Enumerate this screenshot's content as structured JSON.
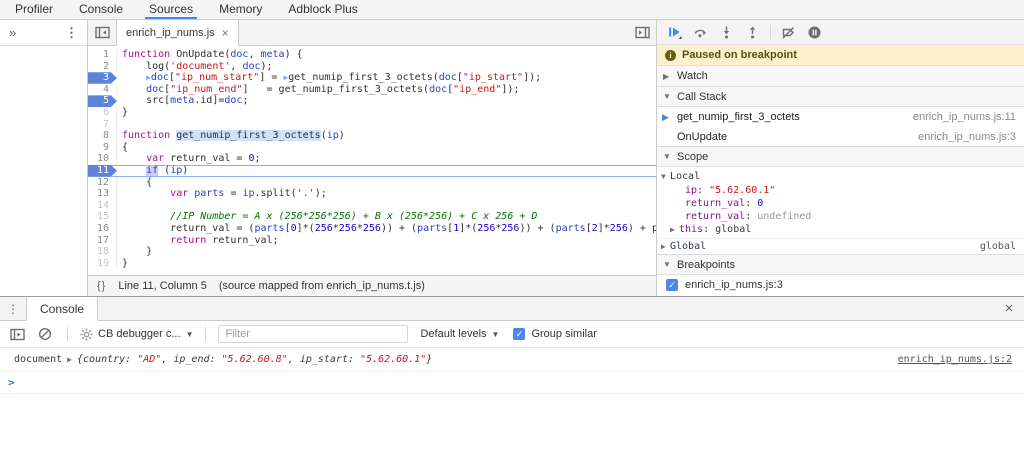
{
  "icons": {
    "caret_down": "▼",
    "close": "×",
    "kebab": "⋮",
    "chevron_double_right": "»",
    "collapsed": "▶",
    "expanded": "▼",
    "check": "✓",
    "info": "i",
    "prompt": ">"
  },
  "colors": {
    "accent_blue": "#4285f4",
    "breakpoint_tag": "#5b84d8",
    "paused_banner_bg": "#fcf1cd",
    "keyword": "#aa0d91",
    "string": "#c41a16",
    "number": "#1c00cf",
    "variable": "#2544cc",
    "comment": "#007400"
  },
  "top_tabs": {
    "items": [
      {
        "label": "Profiler",
        "active": false
      },
      {
        "label": "Console",
        "active": false
      },
      {
        "label": "Sources",
        "active": true
      },
      {
        "label": "Memory",
        "active": false
      },
      {
        "label": "Adblock Plus",
        "active": false
      }
    ]
  },
  "editor": {
    "tab_label": "enrich_ip_nums.js",
    "status": {
      "braces": "{}",
      "position": "Line 11, Column 5",
      "mapping": "(source mapped from enrich_ip_nums.t.js)"
    },
    "current_line": 11,
    "lines": [
      {
        "n": 1,
        "tokens": [
          [
            "kw",
            "function"
          ],
          [
            "pl",
            " OnUpdate("
          ],
          [
            "v",
            "doc"
          ],
          [
            "pl",
            ", "
          ],
          [
            "v",
            "meta"
          ],
          [
            "pl",
            ") {"
          ]
        ]
      },
      {
        "n": 2,
        "tokens": [
          [
            "pl",
            "    log("
          ],
          [
            "str",
            "'document'"
          ],
          [
            "pl",
            ", "
          ],
          [
            "v",
            "doc"
          ],
          [
            "pl",
            ");"
          ]
        ]
      },
      {
        "n": 3,
        "tag": true,
        "tokens": [
          [
            "pl",
            "    "
          ],
          [
            "mark",
            "▶"
          ],
          [
            "v",
            "doc"
          ],
          [
            "pl",
            "["
          ],
          [
            "str",
            "\"ip_num_start\""
          ],
          [
            "pl",
            "] = "
          ],
          [
            "mark",
            "▶"
          ],
          [
            "pl",
            "get_numip_first_3_octets("
          ],
          [
            "v",
            "doc"
          ],
          [
            "pl",
            "["
          ],
          [
            "str",
            "\"ip_start\""
          ],
          [
            "pl",
            "]);"
          ]
        ]
      },
      {
        "n": 4,
        "tokens": [
          [
            "pl",
            "    "
          ],
          [
            "v",
            "doc"
          ],
          [
            "pl",
            "["
          ],
          [
            "str",
            "\"ip_num_end\""
          ],
          [
            "pl",
            "]   = get_numip_first_3_octets("
          ],
          [
            "v",
            "doc"
          ],
          [
            "pl",
            "["
          ],
          [
            "str",
            "\"ip_end\""
          ],
          [
            "pl",
            "]);"
          ]
        ]
      },
      {
        "n": 5,
        "tag": true,
        "tokens": [
          [
            "pl",
            "    src["
          ],
          [
            "v",
            "meta"
          ],
          [
            "pl",
            ".id]="
          ],
          [
            "v",
            "doc"
          ],
          [
            "pl",
            ";"
          ]
        ]
      },
      {
        "n": 6,
        "dim": true,
        "tokens": [
          [
            "pl",
            "}"
          ]
        ]
      },
      {
        "n": 7,
        "dim": true,
        "tokens": []
      },
      {
        "n": 8,
        "tokens": [
          [
            "kw",
            "function"
          ],
          [
            "pl",
            " "
          ],
          [
            "hl",
            "get_numip_first_3_octets"
          ],
          [
            "pl",
            "("
          ],
          [
            "v",
            "ip"
          ],
          [
            "pl",
            ")"
          ]
        ]
      },
      {
        "n": 9,
        "tokens": [
          [
            "pl",
            "{"
          ]
        ]
      },
      {
        "n": 10,
        "tokens": [
          [
            "pl",
            "    "
          ],
          [
            "kw",
            "var"
          ],
          [
            "pl",
            " return_val = "
          ],
          [
            "num",
            "0"
          ],
          [
            "pl",
            ";"
          ]
        ]
      },
      {
        "n": 11,
        "tag": true,
        "current": true,
        "tokens": [
          [
            "pl",
            "    "
          ],
          [
            "kwsel",
            "if"
          ],
          [
            "pl",
            " ("
          ],
          [
            "v",
            "ip"
          ],
          [
            "pl",
            ")"
          ]
        ]
      },
      {
        "n": 12,
        "tokens": [
          [
            "pl",
            "    {"
          ]
        ]
      },
      {
        "n": 13,
        "tokens": [
          [
            "pl",
            "        "
          ],
          [
            "kw",
            "var"
          ],
          [
            "pl",
            " "
          ],
          [
            "v",
            "parts"
          ],
          [
            "pl",
            " = "
          ],
          [
            "v",
            "ip"
          ],
          [
            "pl",
            ".split("
          ],
          [
            "str",
            "'.'"
          ],
          [
            "pl",
            ");"
          ]
        ]
      },
      {
        "n": 14,
        "dim": true,
        "tokens": []
      },
      {
        "n": 15,
        "dim": true,
        "tokens": [
          [
            "pl",
            "        "
          ],
          [
            "cmt",
            "//IP Number = A x (256*256*256) + B x (256*256) + C x 256 + D"
          ]
        ]
      },
      {
        "n": 16,
        "tokens": [
          [
            "pl",
            "        return_val = ("
          ],
          [
            "v",
            "parts"
          ],
          [
            "pl",
            "["
          ],
          [
            "num",
            "0"
          ],
          [
            "pl",
            "]*("
          ],
          [
            "num",
            "256"
          ],
          [
            "pl",
            "*"
          ],
          [
            "num",
            "256"
          ],
          [
            "pl",
            "*"
          ],
          [
            "num",
            "256"
          ],
          [
            "pl",
            ")) + ("
          ],
          [
            "v",
            "parts"
          ],
          [
            "pl",
            "["
          ],
          [
            "num",
            "1"
          ],
          [
            "pl",
            "]*("
          ],
          [
            "num",
            "256"
          ],
          [
            "pl",
            "*"
          ],
          [
            "num",
            "256"
          ],
          [
            "pl",
            ")) + ("
          ],
          [
            "v",
            "parts"
          ],
          [
            "pl",
            "["
          ],
          [
            "num",
            "2"
          ],
          [
            "pl",
            "]*"
          ],
          [
            "num",
            "256"
          ],
          [
            "pl",
            ") + pa"
          ]
        ]
      },
      {
        "n": 17,
        "tokens": [
          [
            "pl",
            "        "
          ],
          [
            "kw",
            "return"
          ],
          [
            "pl",
            " return_val;"
          ]
        ]
      },
      {
        "n": 18,
        "dim": true,
        "tokens": [
          [
            "pl",
            "    }"
          ]
        ]
      },
      {
        "n": 19,
        "dim": true,
        "tokens": [
          [
            "pl",
            "}"
          ]
        ]
      }
    ]
  },
  "debugger": {
    "paused_message": "Paused on breakpoint",
    "watch": {
      "arrow": "▶",
      "label": "Watch"
    },
    "call_stack": {
      "arrow": "▼",
      "label": "Call Stack",
      "frames": [
        {
          "active": true,
          "name": "get_numip_first_3_octets",
          "location": "enrich_ip_nums.js:11"
        },
        {
          "active": false,
          "name": "OnUpdate",
          "location": "enrich_ip_nums.js:3"
        }
      ]
    },
    "scope": {
      "arrow": "▼",
      "label": "Scope",
      "local": {
        "arrow": "▼",
        "label": "Local",
        "vars": [
          {
            "key": "ip",
            "value": "\"5.62.60.1\"",
            "type": "str"
          },
          {
            "key": "return_val",
            "value": "0",
            "type": "num"
          },
          {
            "key": "return_val",
            "value": "undefined",
            "type": "undef"
          },
          {
            "key": "this",
            "value": "global",
            "type": "plain",
            "arrow": "▶"
          }
        ]
      },
      "global": {
        "arrow": "▶",
        "label": "Global",
        "value": "global"
      }
    },
    "breakpoints": {
      "arrow": "▼",
      "label": "Breakpoints",
      "items": [
        {
          "checked": true,
          "label": "enrich_ip_nums.js:3"
        }
      ]
    }
  },
  "console": {
    "tab_label": "Console",
    "toolbar": {
      "context_label": "CB debugger c...",
      "filter_placeholder": "Filter",
      "levels_label": "Default levels",
      "group_similar_label": "Group similar",
      "group_similar_checked": true
    },
    "messages": [
      {
        "name": "document",
        "expander": "▶",
        "preview": {
          "open": "{",
          "close": "}",
          "props": [
            {
              "key": "country",
              "value": "\"AD\""
            },
            {
              "key": "ip_end",
              "value": "\"5.62.60.8\""
            },
            {
              "key": "ip_start",
              "value": "\"5.62.60.1\""
            }
          ]
        },
        "link": "enrich_ip_nums.js:2"
      }
    ],
    "prompt": ">"
  }
}
